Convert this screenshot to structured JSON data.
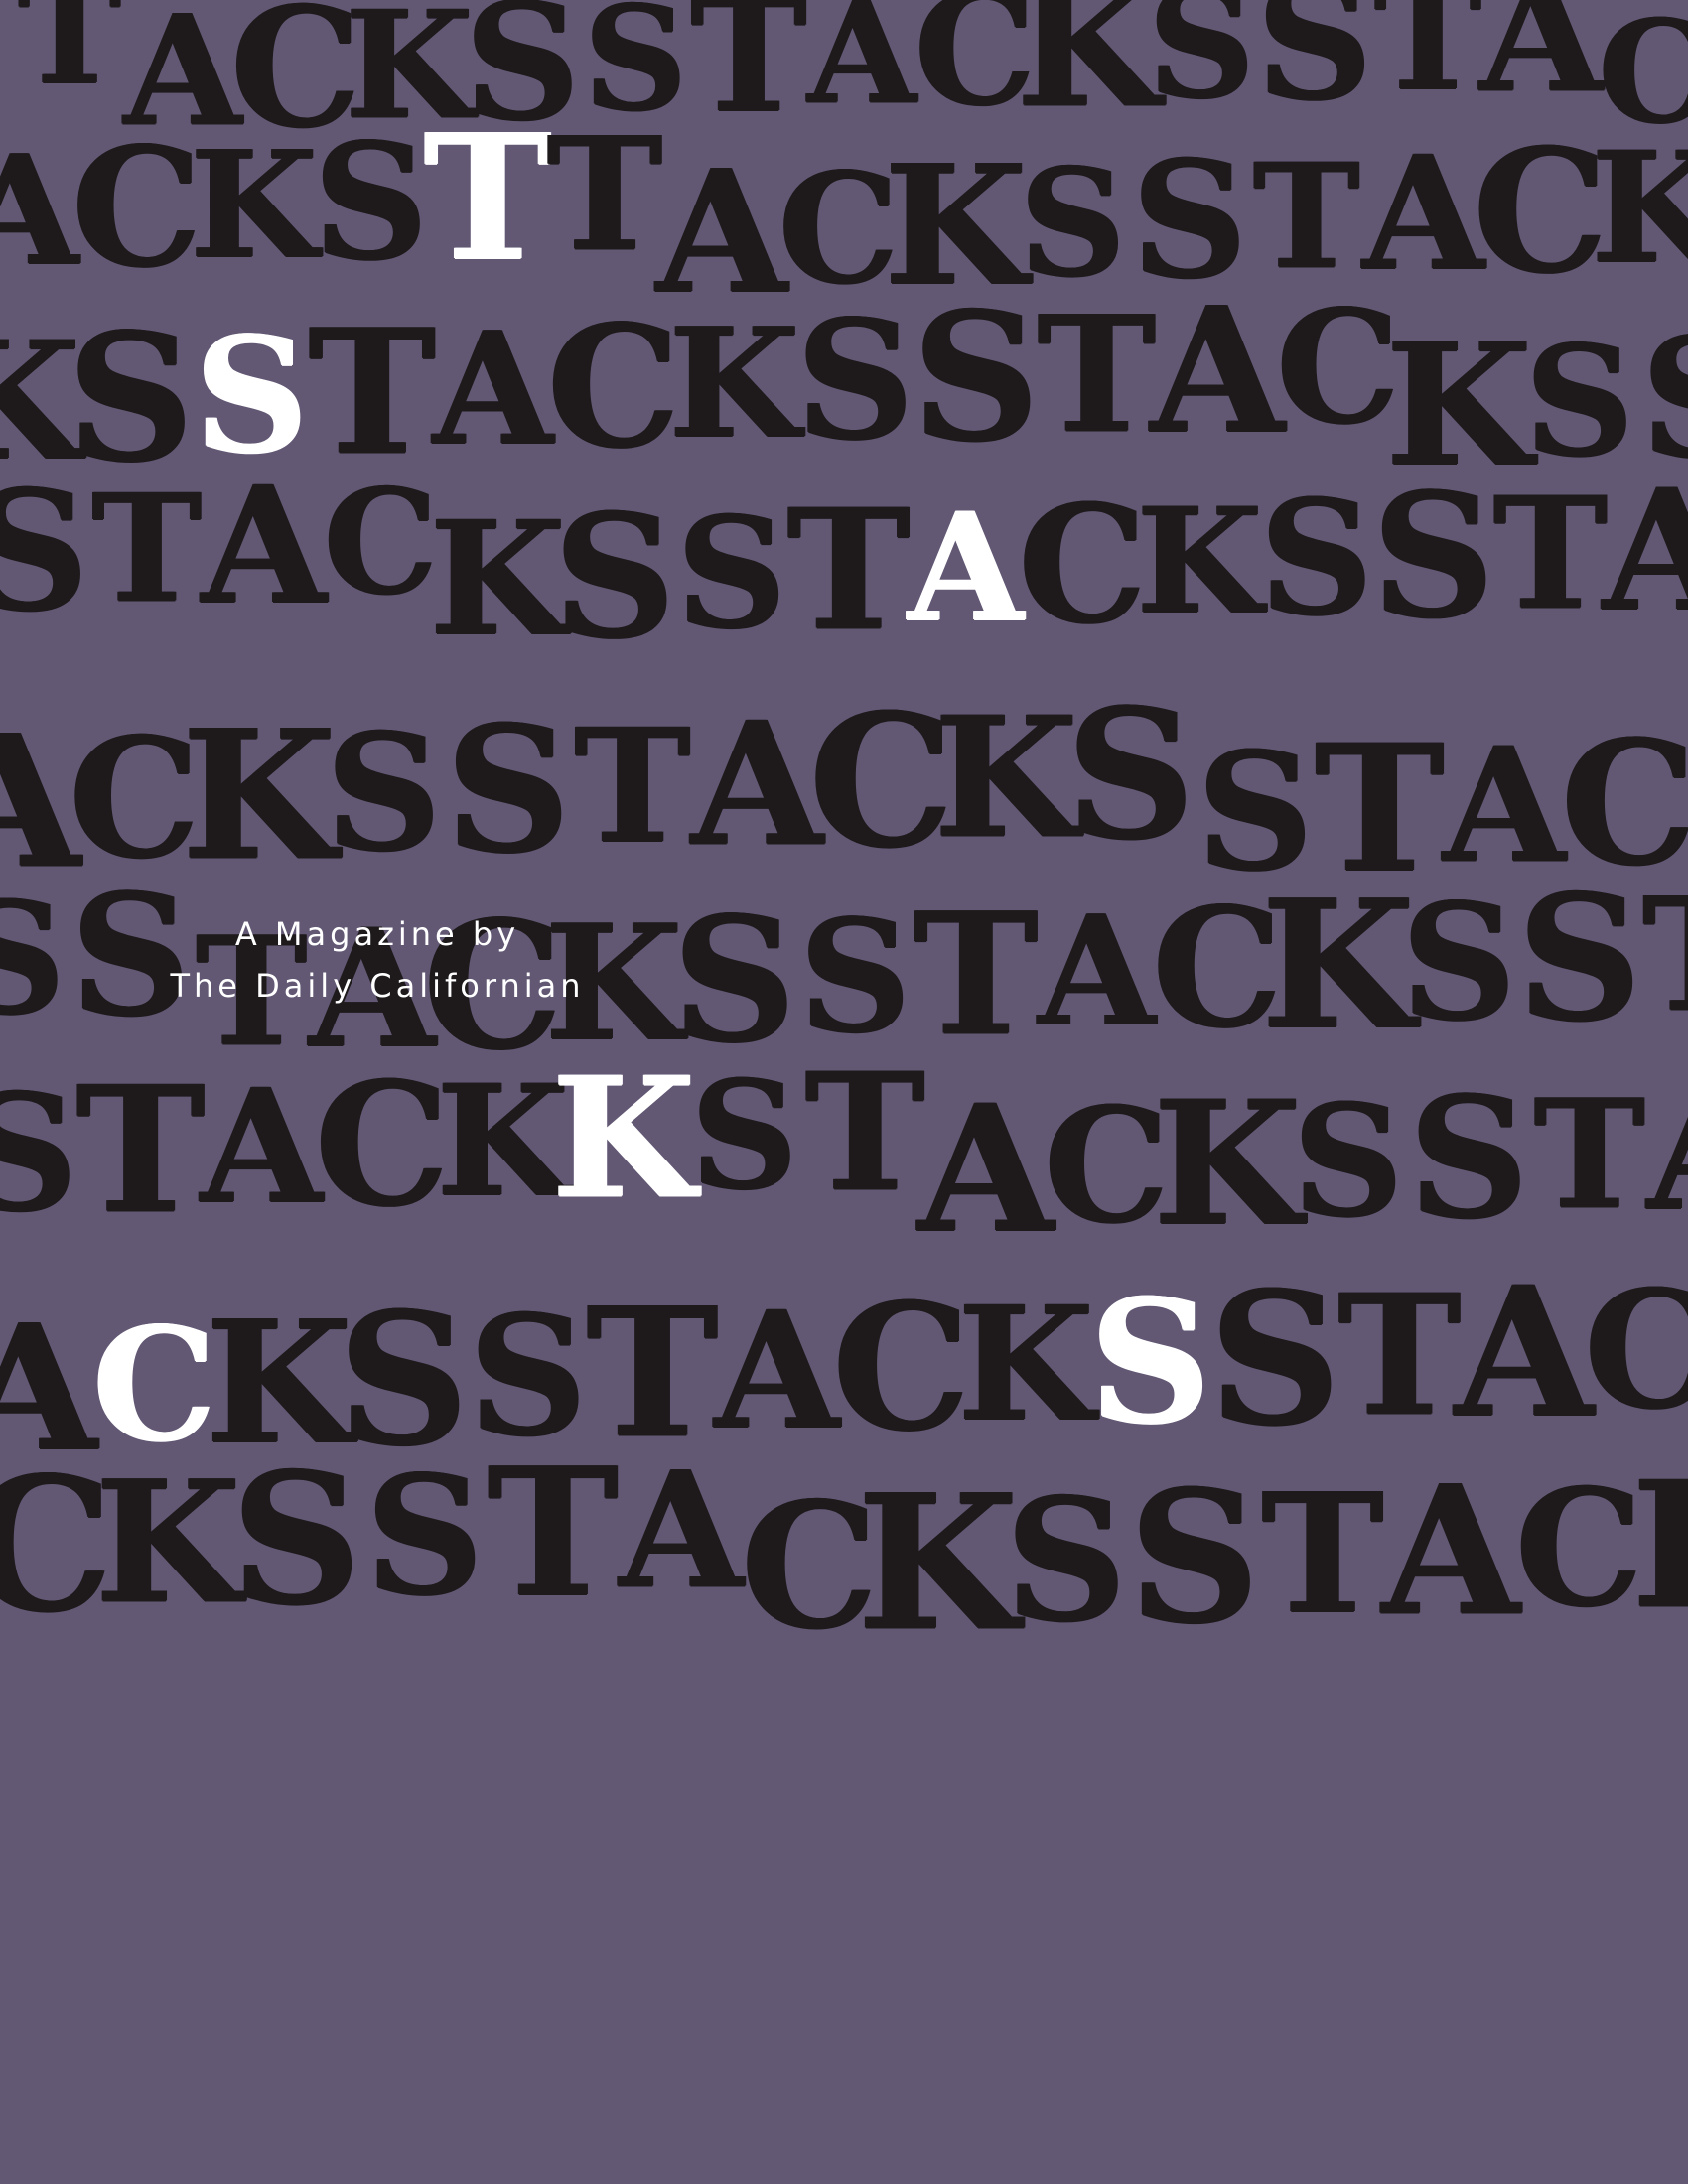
{
  "cover": {
    "title": "STACKS",
    "repeat_word": "STACKS",
    "byline_line1": "A Magazine by",
    "byline_line2": "The Daily Californian"
  },
  "colors": {
    "background": "#625874",
    "letter": "#1e1a1c",
    "highlight": "#ffffff",
    "byline": "#ffffff"
  }
}
